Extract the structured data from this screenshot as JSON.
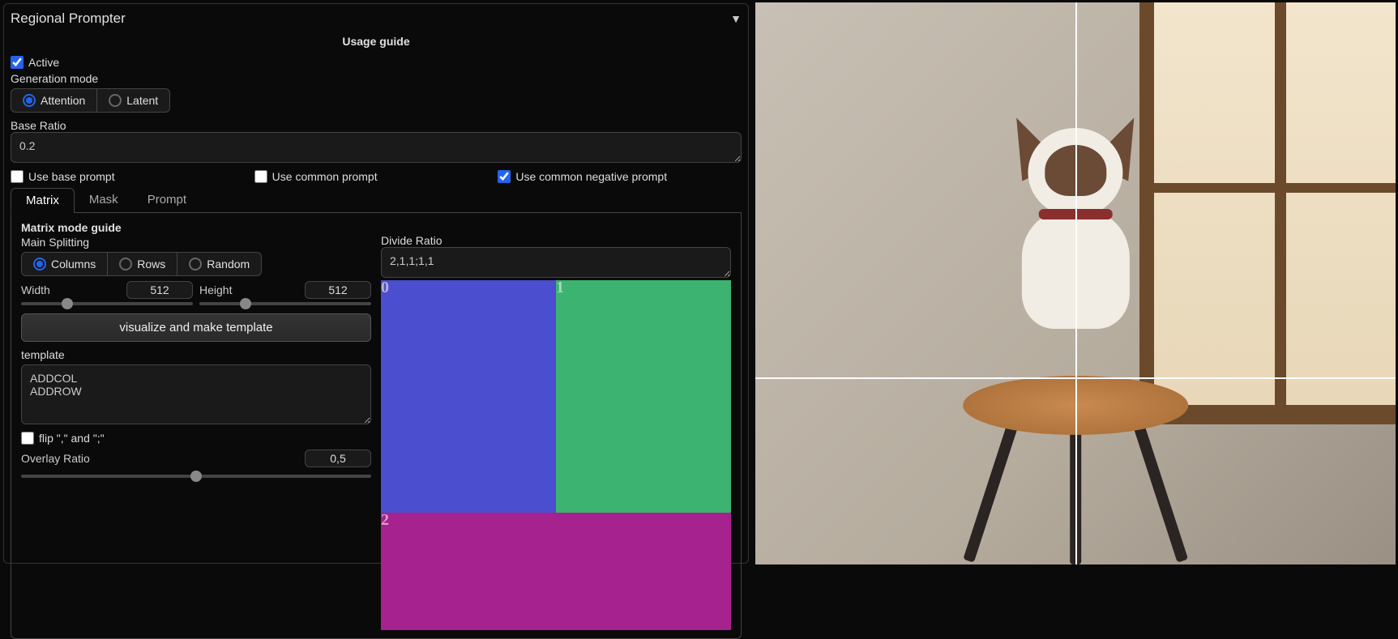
{
  "panel": {
    "title": "Regional Prompter",
    "usage_guide": "Usage guide",
    "active_label": "Active",
    "active_checked": true,
    "generation_mode_label": "Generation mode",
    "gen_modes": [
      "Attention",
      "Latent"
    ],
    "gen_mode_selected": "Attention",
    "base_ratio_label": "Base Ratio",
    "base_ratio_value": "0.2",
    "use_base_prompt": "Use base prompt",
    "use_common_prompt": "Use common prompt",
    "use_common_negative": "Use common negative prompt",
    "use_common_negative_checked": true,
    "tabs": [
      "Matrix",
      "Mask",
      "Prompt"
    ],
    "tab_selected": "Matrix"
  },
  "matrix": {
    "guide": "Matrix mode guide",
    "main_splitting_label": "Main Splitting",
    "split_modes": [
      "Columns",
      "Rows",
      "Random"
    ],
    "split_selected": "Columns",
    "divide_ratio_label": "Divide Ratio",
    "divide_ratio_value": "2,1,1;1,1",
    "width_label": "Width",
    "width_value": "512",
    "height_label": "Height",
    "height_value": "512",
    "visualize_button": "visualize and make template",
    "template_label": "template",
    "template_value": "ADDCOL\nADDROW",
    "flip_label": "flip \",\" and \";\"",
    "overlay_label": "Overlay Ratio",
    "overlay_value": "0,5",
    "preview_regions": [
      "0",
      "1",
      "2"
    ]
  }
}
